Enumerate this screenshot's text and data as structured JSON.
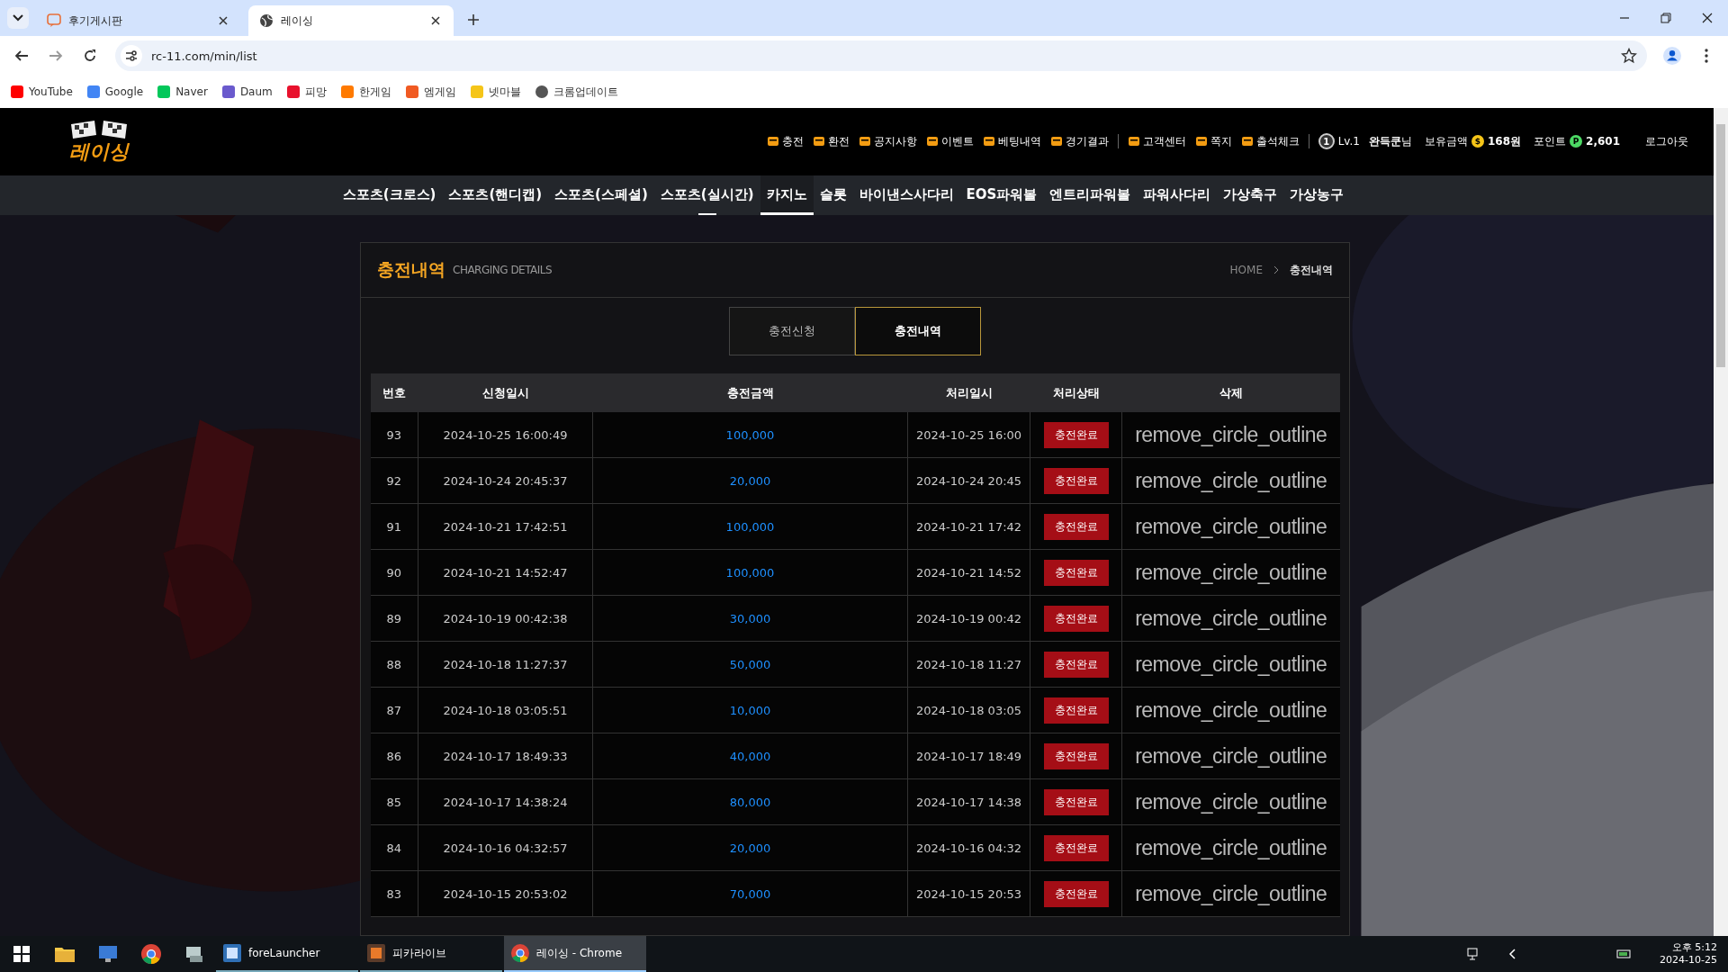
{
  "browser": {
    "tabs": [
      {
        "title": "후기게시판",
        "selected": false
      },
      {
        "title": "레이싱",
        "selected": true
      }
    ],
    "address": "rc-11.com/min/list",
    "bookmarks": [
      "YouTube",
      "Google",
      "Naver",
      "Daum",
      "피망",
      "한게임",
      "엠게임",
      "넷마블",
      "크롬업데이트"
    ]
  },
  "site": {
    "logo": "레이싱",
    "top_menu": [
      "충전",
      "환전",
      "공지사항",
      "이벤트",
      "베팅내역",
      "경기결과",
      "고객센터",
      "쪽지",
      "출석체크"
    ],
    "user": {
      "level_badge": "1",
      "level": "Lv.1",
      "name": "완득쿤",
      "name_suffix": "님",
      "balance_label": "보유금액",
      "balance_badge": "$",
      "balance": "168원",
      "points_label": "포인트",
      "points_badge": "P",
      "points": "2,601",
      "logout": "로그아웃"
    },
    "nav": [
      {
        "label": "스포츠(크로스)",
        "selected": false,
        "hover": false
      },
      {
        "label": "스포츠(핸디캡)",
        "selected": false,
        "hover": false
      },
      {
        "label": "스포츠(스페셜)",
        "selected": false,
        "hover": false
      },
      {
        "label": "스포츠(실시간)",
        "selected": false,
        "hover": true
      },
      {
        "label": "카지노",
        "selected": true,
        "hover": false
      },
      {
        "label": "슬롯",
        "selected": false,
        "hover": false
      },
      {
        "label": "바이낸스사다리",
        "selected": false,
        "hover": false
      },
      {
        "label": "EOS파워볼",
        "selected": false,
        "hover": false
      },
      {
        "label": "엔트리파워볼",
        "selected": false,
        "hover": false
      },
      {
        "label": "파워사다리",
        "selected": false,
        "hover": false
      },
      {
        "label": "가상축구",
        "selected": false,
        "hover": false
      },
      {
        "label": "가상농구",
        "selected": false,
        "hover": false
      }
    ]
  },
  "panel": {
    "title": "충전내역",
    "subtitle": "CHARGING DETAILS",
    "breadcrumb": [
      "HOME",
      "충전내역"
    ],
    "tabs": [
      {
        "label": "충전신청",
        "selected": false
      },
      {
        "label": "충전내역",
        "selected": true
      }
    ],
    "table": {
      "columns": [
        "번호",
        "신청일시",
        "충전금액",
        "처리일시",
        "처리상태",
        "삭제"
      ],
      "rows": [
        {
          "no": "93",
          "requested": "2024-10-25 16:00:49",
          "amount": "100,000",
          "processed": "2024-10-25 16:00",
          "status": "충전완료",
          "delete": "remove_circle_outline"
        },
        {
          "no": "92",
          "requested": "2024-10-24 20:45:37",
          "amount": "20,000",
          "processed": "2024-10-24 20:45",
          "status": "충전완료",
          "delete": "remove_circle_outline"
        },
        {
          "no": "91",
          "requested": "2024-10-21 17:42:51",
          "amount": "100,000",
          "processed": "2024-10-21 17:42",
          "status": "충전완료",
          "delete": "remove_circle_outline"
        },
        {
          "no": "90",
          "requested": "2024-10-21 14:52:47",
          "amount": "100,000",
          "processed": "2024-10-21 14:52",
          "status": "충전완료",
          "delete": "remove_circle_outline"
        },
        {
          "no": "89",
          "requested": "2024-10-19 00:42:38",
          "amount": "30,000",
          "processed": "2024-10-19 00:42",
          "status": "충전완료",
          "delete": "remove_circle_outline"
        },
        {
          "no": "88",
          "requested": "2024-10-18 11:27:37",
          "amount": "50,000",
          "processed": "2024-10-18 11:27",
          "status": "충전완료",
          "delete": "remove_circle_outline"
        },
        {
          "no": "87",
          "requested": "2024-10-18 03:05:51",
          "amount": "10,000",
          "processed": "2024-10-18 03:05",
          "status": "충전완료",
          "delete": "remove_circle_outline"
        },
        {
          "no": "86",
          "requested": "2024-10-17 18:49:33",
          "amount": "40,000",
          "processed": "2024-10-17 18:49",
          "status": "충전완료",
          "delete": "remove_circle_outline"
        },
        {
          "no": "85",
          "requested": "2024-10-17 14:38:24",
          "amount": "80,000",
          "processed": "2024-10-17 14:38",
          "status": "충전완료",
          "delete": "remove_circle_outline"
        },
        {
          "no": "84",
          "requested": "2024-10-16 04:32:57",
          "amount": "20,000",
          "processed": "2024-10-16 04:32",
          "status": "충전완료",
          "delete": "remove_circle_outline"
        },
        {
          "no": "83",
          "requested": "2024-10-15 20:53:02",
          "amount": "70,000",
          "processed": "2024-10-15 20:53",
          "status": "충전완료",
          "delete": "remove_circle_outline"
        }
      ]
    }
  },
  "taskbar": {
    "apps": [
      {
        "label": "foreLauncher",
        "active": false
      },
      {
        "label": "피카라이브",
        "active": false
      },
      {
        "label": "레이싱 - Chrome",
        "active": true
      }
    ],
    "time": "오후 5:12",
    "date": "2024-10-25"
  }
}
